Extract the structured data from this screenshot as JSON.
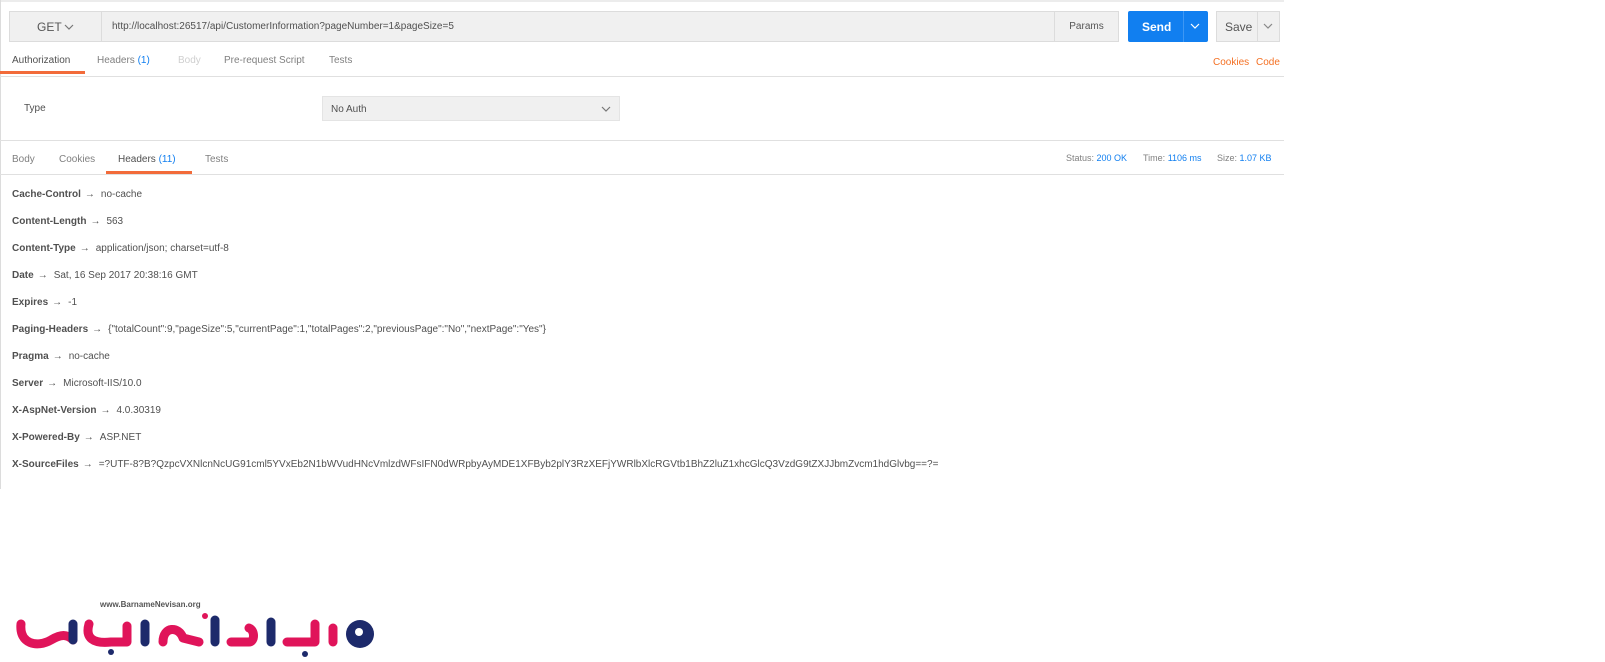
{
  "request": {
    "method": "GET",
    "url": "http://localhost:26517/api/CustomerInformation?pageNumber=1&pageSize=5",
    "params_label": "Params",
    "send_label": "Send",
    "save_label": "Save"
  },
  "request_tabs": [
    {
      "label": "Authorization",
      "count": ""
    },
    {
      "label": "Headers",
      "count": "(1)"
    },
    {
      "label": "Body",
      "count": ""
    },
    {
      "label": "Pre-request Script",
      "count": ""
    },
    {
      "label": "Tests",
      "count": ""
    }
  ],
  "right_links": {
    "cookies": "Cookies",
    "code": "Code"
  },
  "auth": {
    "type_label": "Type",
    "selected": "No Auth"
  },
  "response_tabs": [
    {
      "label": "Body",
      "count": ""
    },
    {
      "label": "Cookies",
      "count": ""
    },
    {
      "label": "Headers",
      "count": "(11)"
    },
    {
      "label": "Tests",
      "count": ""
    }
  ],
  "status": {
    "status_label": "Status:",
    "status_value": "200 OK",
    "time_label": "Time:",
    "time_value": "1106 ms",
    "size_label": "Size:",
    "size_value": "1.07 KB"
  },
  "headers": [
    {
      "key": "Cache-Control",
      "value": "no-cache"
    },
    {
      "key": "Content-Length",
      "value": "563"
    },
    {
      "key": "Content-Type",
      "value": "application/json; charset=utf-8"
    },
    {
      "key": "Date",
      "value": "Sat, 16 Sep 2017 20:38:16 GMT"
    },
    {
      "key": "Expires",
      "value": "-1"
    },
    {
      "key": "Paging-Headers",
      "value": "{\"totalCount\":9,\"pageSize\":5,\"currentPage\":1,\"totalPages\":2,\"previousPage\":\"No\",\"nextPage\":\"Yes\"}"
    },
    {
      "key": "Pragma",
      "value": "no-cache"
    },
    {
      "key": "Server",
      "value": "Microsoft-IIS/10.0"
    },
    {
      "key": "X-AspNet-Version",
      "value": "4.0.30319"
    },
    {
      "key": "X-Powered-By",
      "value": "ASP.NET"
    },
    {
      "key": "X-SourceFiles",
      "value": "=?UTF-8?B?QzpcVXNlcnNcUG91cml5YVxEb2N1bWVudHNcVmlzdWFsIFN0dWRpbyAyMDE1XFByb2plY3RzXEFjYWRlbXlcRGVtb1BhZ2luZ1xhcGlcQ3VzdG9tZXJJbmZvcm1hdGlvbg==?="
    }
  ],
  "header_arrow": "→",
  "logo": {
    "url_text": "www.BarnameNevisan.org"
  },
  "colors": {
    "accent_blue": "#117ff0",
    "accent_orange": "#f26b3a",
    "logo_pink": "#e0145a",
    "logo_navy": "#1d2a6b"
  }
}
